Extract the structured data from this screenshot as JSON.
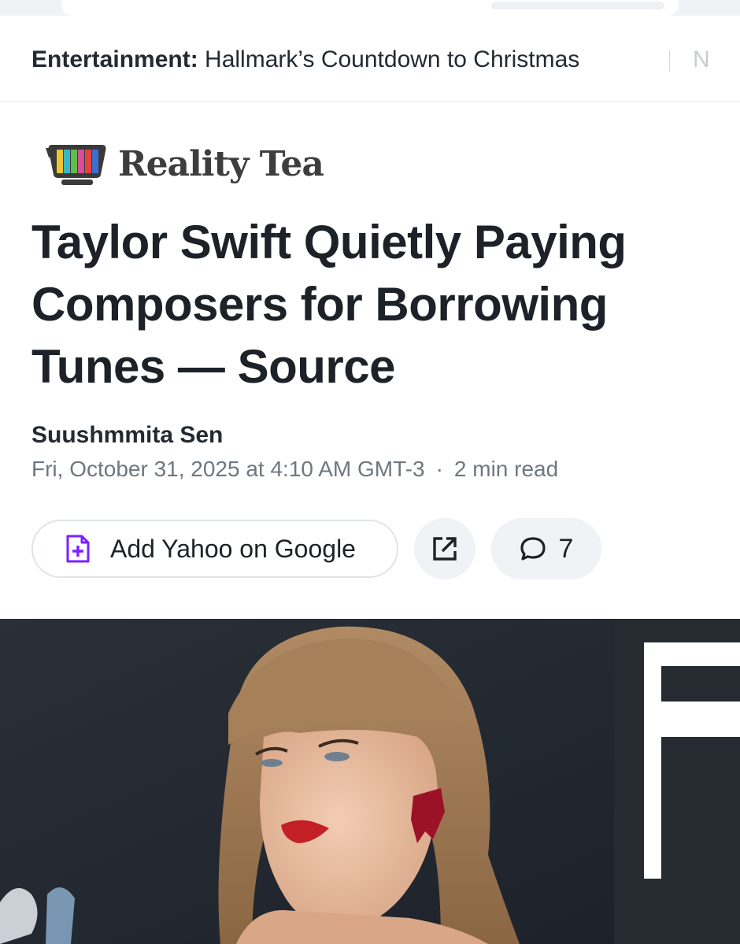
{
  "ticker": {
    "category": "Entertainment:",
    "headline": "Hallmark’s Countdown to Christmas",
    "next_partial": "N"
  },
  "brand": {
    "name": "Reality Tea",
    "icon": "tv-logo"
  },
  "article": {
    "headline": "Taylor Swift Quietly Paying Composers for Borrowing Tunes — Source",
    "author": "Suushmmita Sen",
    "date": "Fri, October 31, 2025 at 4:10 AM GMT-3",
    "separator": "·",
    "read_time": "2 min read"
  },
  "actions": {
    "add_source_label": "Add Yahoo on Google",
    "add_source_icon": "add-document-icon",
    "share_icon": "share-icon",
    "comments_icon": "comment-icon",
    "comment_count": "7"
  },
  "colors": {
    "accent_purple": "#7e1fff",
    "text_dark": "#1d2228",
    "text_muted": "#6e7780",
    "button_bg": "#f0f2f5"
  }
}
